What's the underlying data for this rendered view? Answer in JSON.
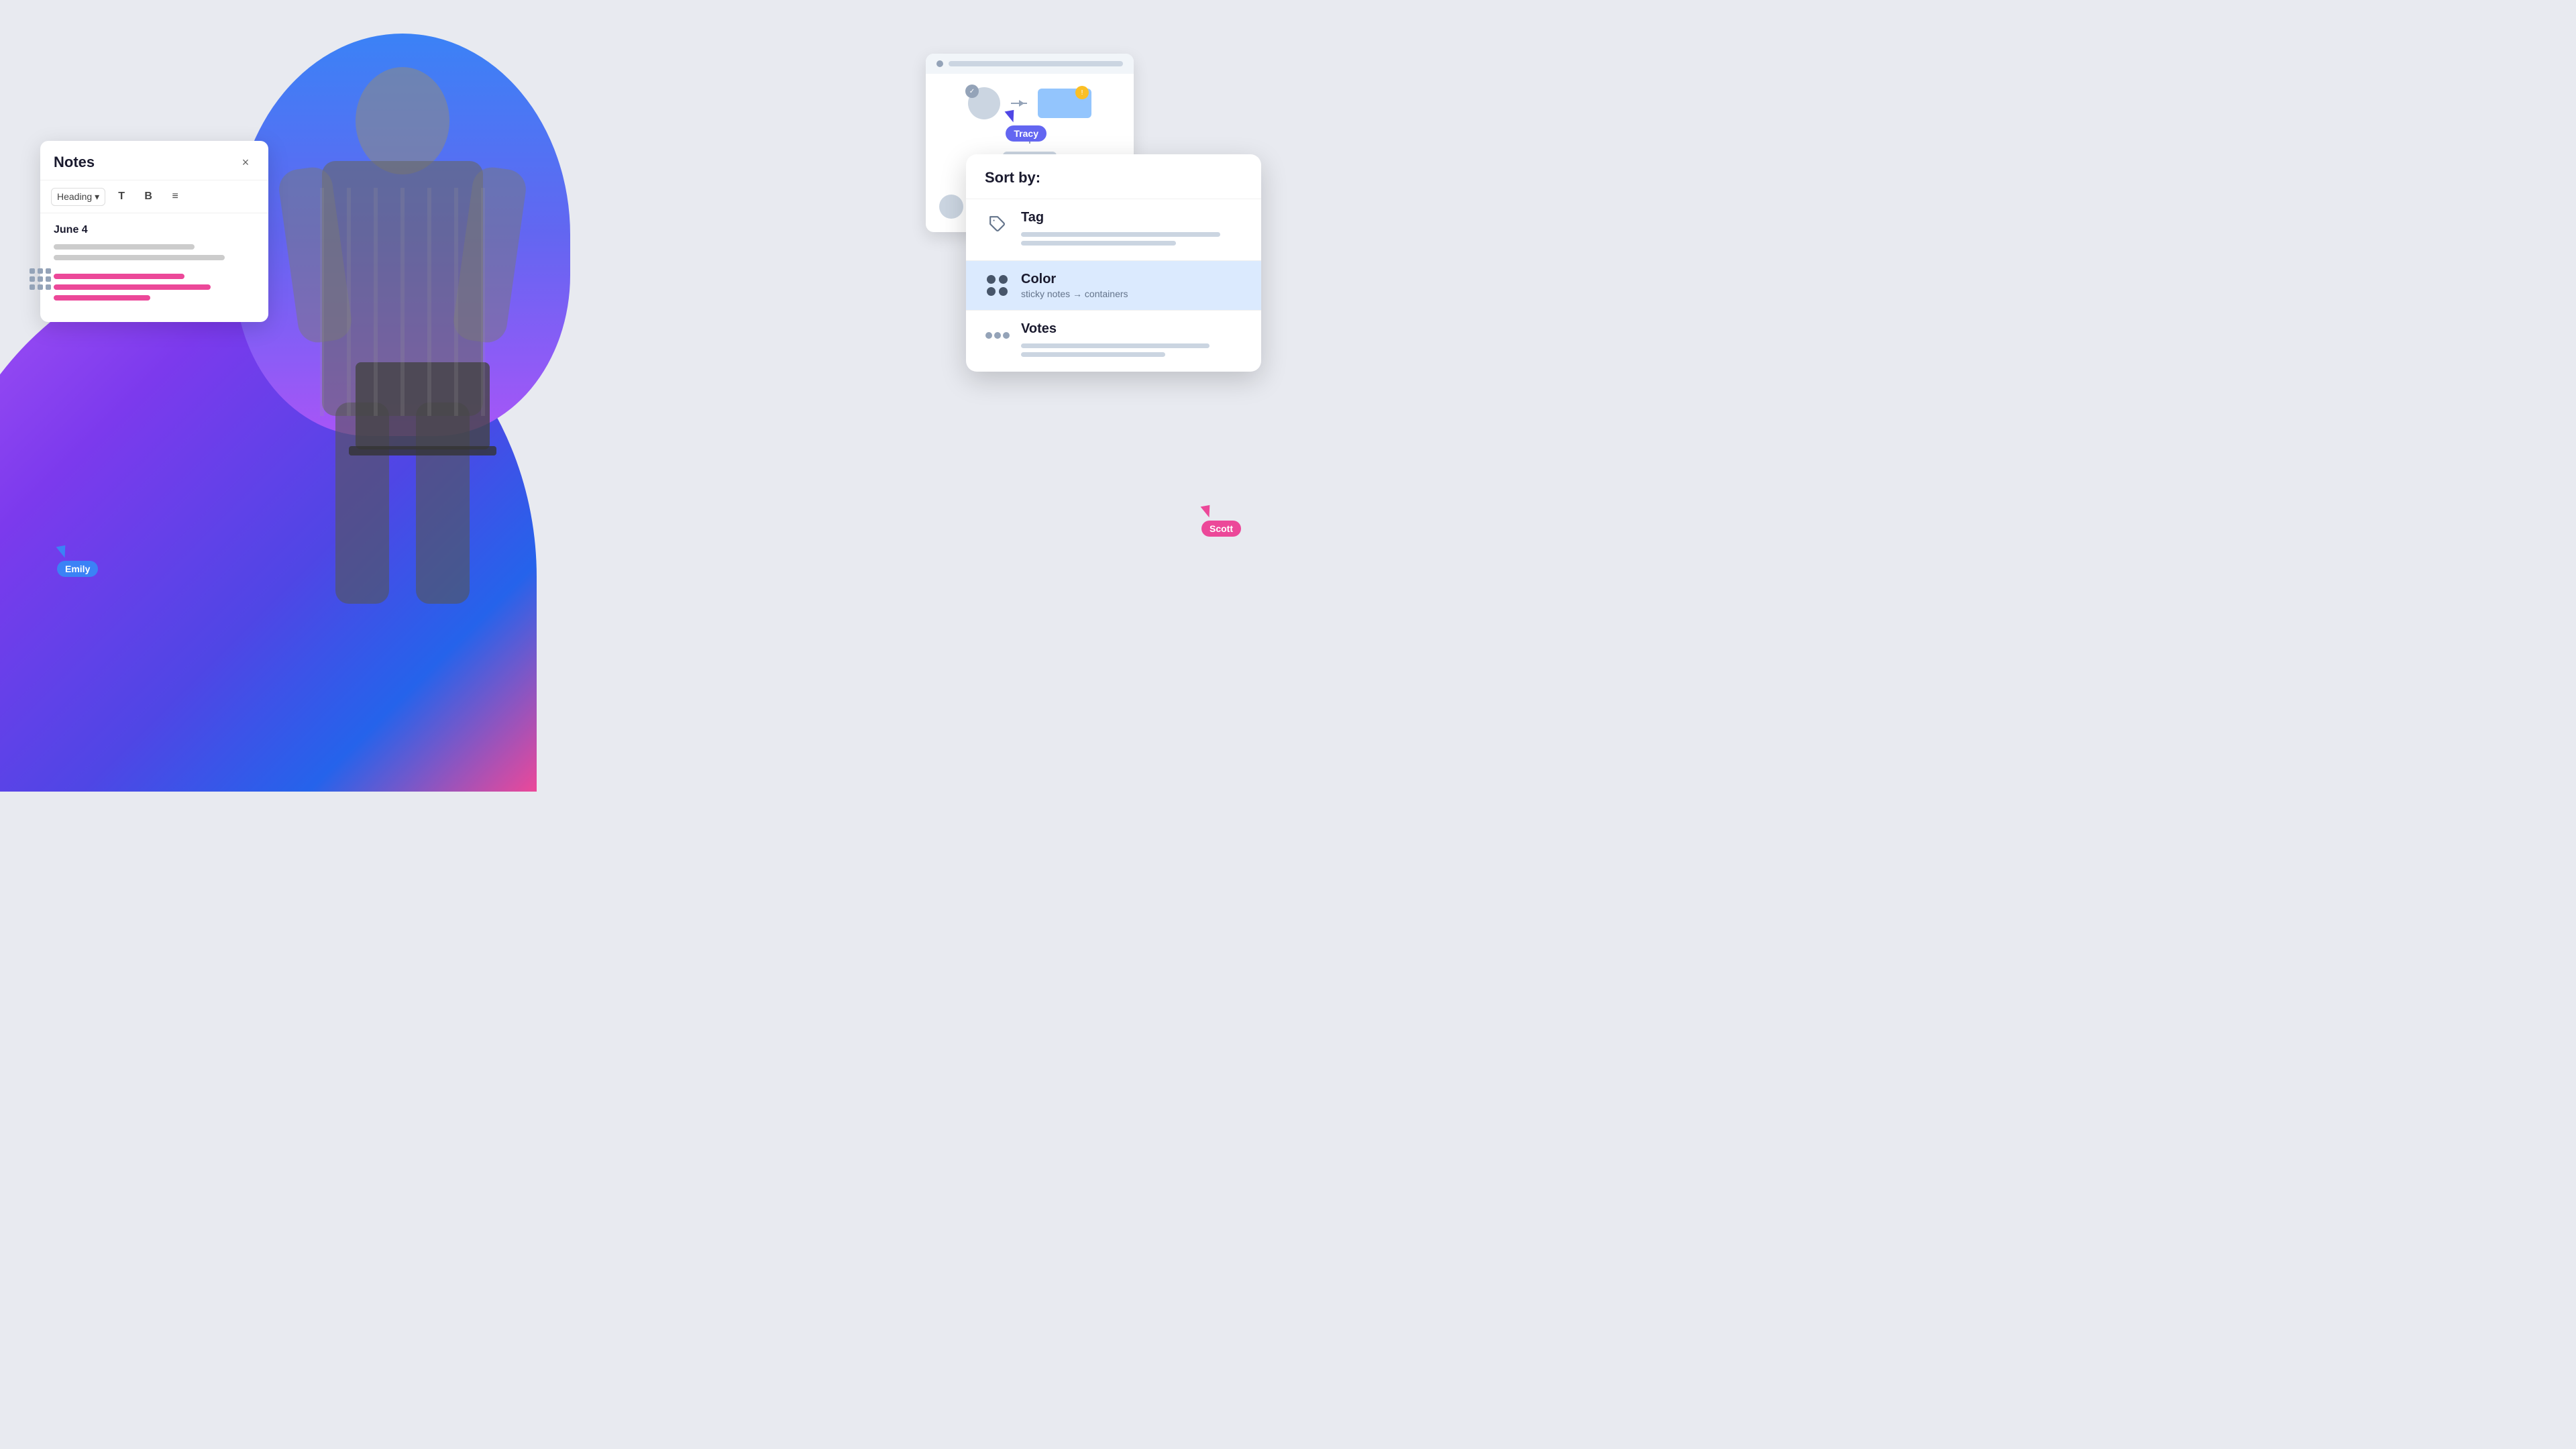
{
  "background": {
    "arc_color_start": "#a855f7",
    "arc_color_end": "#2563eb"
  },
  "notes_panel": {
    "title": "Notes",
    "close_icon": "×",
    "toolbar": {
      "heading_label": "Heading",
      "dropdown_icon": "▾",
      "text_btn": "T",
      "bold_btn": "B",
      "list_btn": "≡"
    },
    "date": "June 4",
    "text_lines": [
      {
        "width": "70%",
        "type": "grey"
      },
      {
        "width": "85%",
        "type": "grey"
      },
      {
        "width": "65%",
        "type": "pink"
      },
      {
        "width": "75%",
        "type": "pink"
      },
      {
        "width": "50%",
        "type": "pink"
      }
    ]
  },
  "sort_panel": {
    "title": "Sort by:",
    "items": [
      {
        "id": "tag",
        "label": "Tag",
        "icon": "tag-icon",
        "active": false
      },
      {
        "id": "color",
        "label": "Color",
        "sublabel": "sticky notes → containers",
        "icon": "color-dots-icon",
        "active": true
      },
      {
        "id": "votes",
        "label": "Votes",
        "icon": "votes-icon",
        "active": false
      }
    ]
  },
  "cursors": {
    "emily": {
      "label": "Emily",
      "color": "#3b82f6"
    },
    "tracy": {
      "label": "Tracy",
      "color": "#6366f1"
    },
    "scott": {
      "label": "Scott",
      "color": "#ec4899"
    }
  },
  "diagram_panel": {
    "shapes": [
      "circle",
      "rect-blue",
      "rect-grey"
    ],
    "has_check": true,
    "has_warn": true
  },
  "ui": {
    "font_family": "-apple-system, BlinkMacSystemFont, 'Segoe UI', sans-serif"
  }
}
